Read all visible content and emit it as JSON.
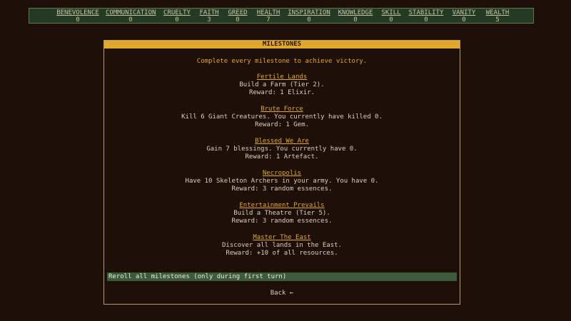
{
  "resources": [
    {
      "name": "BENEVOLENCE",
      "value": "0"
    },
    {
      "name": "COMMUNICATION",
      "value": "0"
    },
    {
      "name": "CRUELTY",
      "value": "0"
    },
    {
      "name": "FAITH",
      "value": "3"
    },
    {
      "name": "GREED",
      "value": "0"
    },
    {
      "name": "HEALTH",
      "value": "7"
    },
    {
      "name": "INSPIRATION",
      "value": "0"
    },
    {
      "name": "KNOWLEDGE",
      "value": "0"
    },
    {
      "name": "SKILL",
      "value": "0"
    },
    {
      "name": "STABILITY",
      "value": "0"
    },
    {
      "name": "VANITY",
      "value": "0"
    },
    {
      "name": "WEALTH",
      "value": "5"
    }
  ],
  "panel": {
    "title": "MILESTONES",
    "intro": "Complete every milestone to achieve victory.",
    "milestones": [
      {
        "title": "Fertile Lands",
        "description": "Build a Farm (Tier 2).",
        "reward": "Reward: 1 Elixir."
      },
      {
        "title": "Brute Force",
        "description": "Kill 6 Giant Creatures. You currently have killed 0.",
        "reward": "Reward: 1 Gem."
      },
      {
        "title": "Blessed We Are",
        "description": "Gain 7 blessings. You currently have 0.",
        "reward": "Reward: 1 Artefact."
      },
      {
        "title": "Necropolis",
        "description": "Have 10 Skeleton Archers in your army. You have 0.",
        "reward": "Reward: 3 random essences."
      },
      {
        "title": "Entertainment Prevails",
        "description": "Build a Theatre (Tier 5).",
        "reward": "Reward: 3 random essences."
      },
      {
        "title": "Master The East",
        "description": "Discover all lands in the East.",
        "reward": "Reward: +10 of all resources."
      }
    ],
    "reroll_label": "Reroll all milestones (only during first turn)",
    "back_label": "Back ←"
  }
}
